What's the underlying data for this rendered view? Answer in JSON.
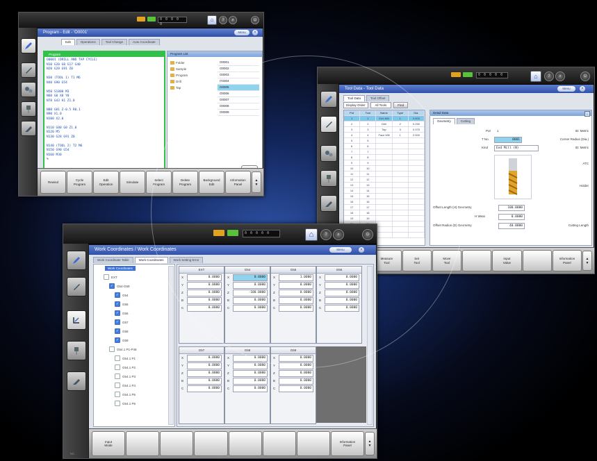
{
  "program_screen": {
    "title": "Program - Edit - 'O0001'",
    "menu_label": "Menu",
    "tabs": [
      "Edit",
      "Operations",
      "Tool Change",
      "Auto Coordinate"
    ],
    "editor_header": "Program",
    "editor_lines": [
      "O0001 (DRILL AND TAP CYCLE)",
      "N10 G20 G0 G17 G40",
      "N20 G28 G91 Z0",
      "",
      "N30 (TOOL 1) T1 M6",
      "N40 G90 G54",
      "",
      "N50 S1800 M3",
      "N60 G0 X0 Y0",
      "N70 G43 H1 Z1.0",
      "",
      "N80 G81 Z-0.5 R0.1",
      "N90 X1.0",
      "N100 X2.0",
      "",
      "N110 G80 G0 Z1.0",
      "N120 M5",
      "N130 G28 G91 Z0",
      "",
      "N140 (TOOL 2) T2 M6",
      "N150 G90 G54",
      "N160 M30",
      "%"
    ],
    "right_panel_title": "Program List",
    "right_items": [
      "Folder",
      "Sample",
      "Program",
      "Drill",
      "Tap"
    ],
    "right_list": [
      "O0001",
      "O0002",
      "O0003",
      "O0004",
      "O0005",
      "O0006",
      "O0007",
      "O0008",
      "O0009"
    ],
    "bottom_keys": [
      {
        "line1": "Rewind",
        "line2": ""
      },
      {
        "line1": "Cycle",
        "line2": "Program"
      },
      {
        "line1": "Edit",
        "line2": "Operation"
      },
      {
        "line1": "Simulate",
        "line2": ""
      },
      {
        "line1": "Select",
        "line2": "Program"
      },
      {
        "line1": "Delete",
        "line2": "Program"
      },
      {
        "line1": "Background",
        "line2": "Edit"
      },
      {
        "line1": "Information",
        "line2": "Panel"
      }
    ],
    "digits": "0 0 0 0 0"
  },
  "tool_screen": {
    "title": "Tool Data - Tool Data",
    "menu_label": "Menu",
    "tabs": [
      "Tool Data",
      "Tool Offset"
    ],
    "filter_label": "Display Order",
    "filter_value": "All Tools",
    "find_label": "Find",
    "table_header": [
      "Pot",
      "Tool",
      "Name",
      "Type",
      "Dia."
    ],
    "table_rows": [
      [
        "1",
        "1",
        "End Mill",
        "1",
        "0.500"
      ],
      [
        "2",
        "2",
        "Drill",
        "2",
        "0.250"
      ],
      [
        "3",
        "3",
        "Tap",
        "3",
        "0.375"
      ],
      [
        "4",
        "4",
        "Face Mill",
        "1",
        "2.000"
      ],
      [
        "5",
        "5",
        "",
        "",
        ""
      ],
      [
        "6",
        "6",
        "",
        "",
        ""
      ],
      [
        "7",
        "7",
        "",
        "",
        ""
      ],
      [
        "8",
        "8",
        "",
        "",
        ""
      ],
      [
        "9",
        "9",
        "",
        "",
        ""
      ],
      [
        "10",
        "10",
        "",
        "",
        ""
      ],
      [
        "11",
        "11",
        "",
        "",
        ""
      ],
      [
        "12",
        "12",
        "",
        "",
        ""
      ],
      [
        "13",
        "13",
        "",
        "",
        ""
      ],
      [
        "14",
        "14",
        "",
        "",
        ""
      ],
      [
        "15",
        "15",
        "",
        "",
        ""
      ],
      [
        "16",
        "16",
        "",
        "",
        ""
      ],
      [
        "17",
        "17",
        "",
        "",
        ""
      ],
      [
        "18",
        "18",
        "",
        "",
        ""
      ],
      [
        "19",
        "19",
        "",
        "",
        ""
      ],
      [
        "20",
        "20",
        "",
        "",
        ""
      ],
      [
        "21",
        "21",
        "",
        "",
        ""
      ],
      [
        "22",
        "22",
        "",
        "",
        ""
      ]
    ],
    "detail_title": "Detail Data",
    "detail_tabs": [
      "Geometry",
      "Cutting"
    ],
    "detail_fields": [
      {
        "label": "Pot",
        "value": "1"
      },
      {
        "label": "T No.",
        "value": "0001"
      },
      {
        "label": "Kind",
        "value": "End Mill (N)"
      }
    ],
    "right_notes": [
      "ID: Metric",
      "Corner Radius (Dia.)",
      "ID: Metric",
      "ATC",
      "Holder"
    ],
    "offset_fields": [
      {
        "label": "Offset Length (H) Geometry",
        "value": "100.0000"
      },
      {
        "label": "H Wear",
        "value": "0.0000"
      },
      {
        "label": "Offset Radius (D) Geometry",
        "value": "40.0000"
      }
    ],
    "offset_right_label": "Cutting Length",
    "bottom_keys": [
      {
        "line1": "",
        "line2": ""
      },
      {
        "line1": "Measure",
        "line2": "Tool"
      },
      {
        "line1": "Set",
        "line2": "Tool"
      },
      {
        "line1": "Move",
        "line2": "Tool"
      },
      {
        "line1": "",
        "line2": ""
      },
      {
        "line1": "Input",
        "line2": "Value"
      },
      {
        "line1": "",
        "line2": ""
      },
      {
        "line1": "Information",
        "line2": "Panel"
      }
    ],
    "digits": "0 0 0 0 0"
  },
  "work_screen": {
    "title": "Work Coordinates / Work Coordinates",
    "menu_label": "Menu",
    "tabs": [
      "Work Coordinate Table",
      "Work Coordinates",
      "Work Setting Error"
    ],
    "tree_root": "Work Coordinates",
    "tree_items": [
      {
        "label": "EXT",
        "checked": false,
        "indent": 0
      },
      {
        "label": "G54-G59",
        "checked": true,
        "indent": 1
      },
      {
        "label": "G54",
        "checked": true,
        "indent": 2
      },
      {
        "label": "G55",
        "checked": true,
        "indent": 2
      },
      {
        "label": "G56",
        "checked": true,
        "indent": 2
      },
      {
        "label": "G57",
        "checked": true,
        "indent": 2
      },
      {
        "label": "G58",
        "checked": true,
        "indent": 2
      },
      {
        "label": "G59",
        "checked": true,
        "indent": 2
      },
      {
        "label": "G54.1 P1-P48",
        "checked": false,
        "indent": 1
      },
      {
        "label": "G54.1 P1",
        "checked": false,
        "indent": 2
      },
      {
        "label": "G54.1 P2",
        "checked": false,
        "indent": 2
      },
      {
        "label": "G54.1 P3",
        "checked": false,
        "indent": 2
      },
      {
        "label": "G54.1 P4",
        "checked": false,
        "indent": 2
      },
      {
        "label": "G54.1 P5",
        "checked": false,
        "indent": 2
      },
      {
        "label": "G54.1 P6",
        "checked": false,
        "indent": 2
      }
    ],
    "blocks_row1": [
      {
        "name": "EXT",
        "values": [
          "0.0000",
          "0.0000",
          "0.0000",
          "0.0000",
          "0.0000"
        ],
        "selected": -1
      },
      {
        "name": "G54",
        "values": [
          "0.0000",
          "0.0000",
          "-100.0000",
          "0.0000",
          "0.0000"
        ],
        "selected": 0
      },
      {
        "name": "G55",
        "values": [
          "1.0000",
          "0.0000",
          "0.0000",
          "0.0000",
          "0.0000"
        ],
        "selected": -1
      },
      {
        "name": "G56",
        "values": [
          "0.0000",
          "0.0000",
          "0.0000",
          "0.0000",
          "0.0000"
        ],
        "selected": -1
      }
    ],
    "blocks_row2": [
      {
        "name": "G57",
        "values": [
          "0.0000",
          "0.0000",
          "0.0000",
          "0.0000",
          "0.0000"
        ],
        "selected": -1
      },
      {
        "name": "G58",
        "values": [
          "0.0000",
          "0.0000",
          "0.0000",
          "0.0000",
          "0.0000"
        ],
        "selected": -1
      },
      {
        "name": "G59",
        "values": [
          "0.0000",
          "0.0000",
          "0.0000",
          "0.0000",
          "0.0000"
        ],
        "selected": -1
      }
    ],
    "axes": [
      "X",
      "Y",
      "Z",
      "B",
      "C"
    ],
    "bottom_keys": [
      {
        "line1": "Input",
        "line2": "Mode"
      },
      {
        "line1": "",
        "line2": ""
      },
      {
        "line1": "",
        "line2": ""
      },
      {
        "line1": "",
        "line2": ""
      },
      {
        "line1": "",
        "line2": ""
      },
      {
        "line1": "",
        "line2": ""
      },
      {
        "line1": "",
        "line2": ""
      },
      {
        "line1": "Information",
        "line2": "Panel"
      }
    ],
    "digits": "0 0 0 0 0",
    "sidebar_footer": "NC"
  }
}
